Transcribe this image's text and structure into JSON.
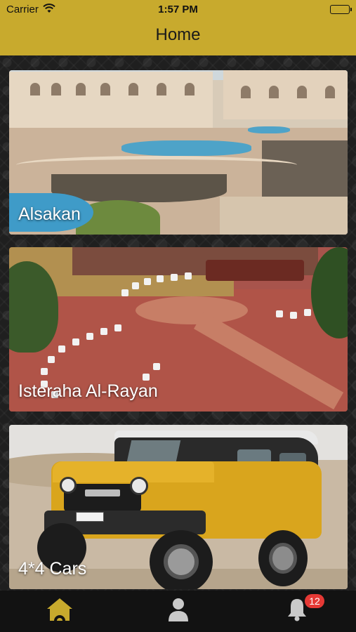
{
  "status_bar": {
    "carrier": "Carrier",
    "time": "1:57 PM"
  },
  "header": {
    "title": "Home"
  },
  "cards": [
    {
      "label": "Alsakan"
    },
    {
      "label": "Isteraha Al-Rayan"
    },
    {
      "label": "4*4 Cars"
    }
  ],
  "tab_bar": {
    "items": [
      {
        "icon": "home-icon",
        "active": true
      },
      {
        "icon": "person-icon",
        "active": false
      },
      {
        "icon": "bell-icon",
        "active": false,
        "badge": "12"
      }
    ]
  },
  "colors": {
    "accent": "#c8aa2d",
    "tab_active": "#c8aa2d",
    "tab_inactive": "#c9c9c9",
    "badge": "#e53935"
  }
}
